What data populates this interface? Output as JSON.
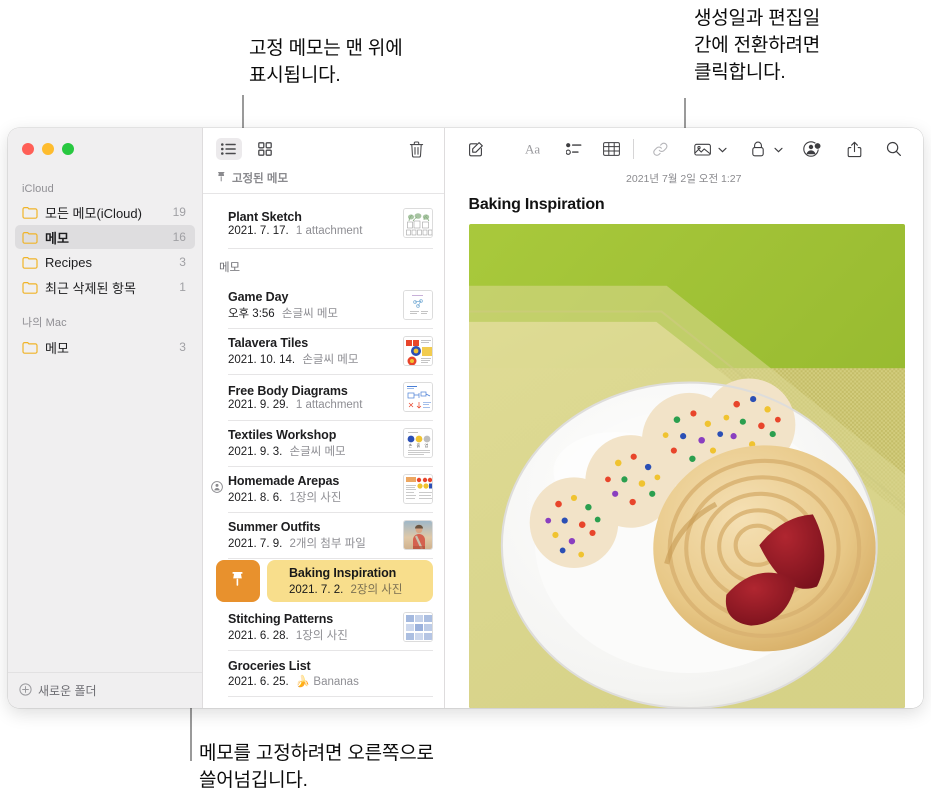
{
  "callouts": [
    {
      "id": "pinned-top",
      "text": "고정 메모는 맨 위에\n표시됩니다."
    },
    {
      "id": "date-toggle",
      "text": "생성일과 편집일\n간에 전환하려면\n클릭합니다."
    },
    {
      "id": "swipe-pin",
      "text": "메모를 고정하려면 오른쪽으로\n쓸어넘깁니다."
    }
  ],
  "window": {
    "traffic_lights": [
      "close",
      "minimize",
      "zoom"
    ],
    "sidebar": {
      "sections": [
        {
          "label": "iCloud",
          "items": [
            {
              "label": "모든 메모(iCloud)",
              "count": "19",
              "selected": false
            },
            {
              "label": "메모",
              "count": "16",
              "selected": true
            },
            {
              "label": "Recipes",
              "count": "3",
              "selected": false
            },
            {
              "label": "최근 삭제된 항목",
              "count": "1",
              "selected": false
            }
          ]
        },
        {
          "label": "나의 Mac",
          "items": [
            {
              "label": "메모",
              "count": "3",
              "selected": false
            }
          ]
        }
      ],
      "footer": {
        "icon": "plus-circle-icon",
        "label": "새로운 폴더"
      }
    },
    "note_list": {
      "toolbar": {
        "list_view_icon": "list-view-icon",
        "gallery_view_icon": "gallery-view-icon",
        "delete_icon": "trash-icon",
        "active_view": "list"
      },
      "pinned_group": {
        "icon": "pin-icon",
        "label": "고정된 메모"
      },
      "pinned_notes": [
        {
          "title": "Plant Sketch",
          "date": "2021. 7. 17.",
          "meta": "1 attachment",
          "thumb": "plant-sketch-thumb",
          "shared": false
        }
      ],
      "notes_group_label": "메모",
      "notes": [
        {
          "title": "Game Day",
          "date": "오후 3:56",
          "meta": "손글씨 메모",
          "thumb": "game-day-thumb",
          "shared": false
        },
        {
          "title": "Talavera Tiles",
          "date": "2021. 10. 14.",
          "meta": "손글씨 메모",
          "thumb": "talavera-thumb",
          "shared": false
        },
        {
          "title": "Free Body Diagrams",
          "date": "2021. 9. 29.",
          "meta": "1 attachment",
          "thumb": "free-body-thumb",
          "shared": false
        },
        {
          "title": "Textiles Workshop",
          "date": "2021. 9. 3.",
          "meta": "손글씨 메모",
          "thumb": "textiles-thumb",
          "shared": false
        },
        {
          "title": "Homemade Arepas",
          "date": "2021. 8. 6.",
          "meta": "1장의 사진",
          "thumb": "arepas-thumb",
          "shared": true
        },
        {
          "title": "Summer Outfits",
          "date": "2021. 7. 9.",
          "meta": "2개의 첨부 파일",
          "thumb": "summer-outfits-thumb",
          "shared": false
        }
      ],
      "swiped_note": {
        "pin_action_icon": "pin-icon",
        "title": "Baking Inspiration",
        "date": "2021. 7. 2.",
        "meta": "2장의 사진"
      },
      "notes_after": [
        {
          "title": "Stitching Patterns",
          "date": "2021. 6. 28.",
          "meta": "1장의 사진",
          "thumb": "stitching-thumb",
          "shared": false
        },
        {
          "title": "Groceries List",
          "date": "2021. 6. 25.",
          "meta": "🍌 Bananas",
          "thumb": "",
          "shared": false
        }
      ]
    },
    "detail": {
      "toolbar": [
        {
          "name": "compose-icon"
        },
        {
          "name": "format-text-icon"
        },
        {
          "name": "checklist-icon"
        },
        {
          "name": "table-icon"
        },
        {
          "name": "link-icon"
        },
        {
          "name": "media-icon",
          "chevron": true
        },
        {
          "name": "lock-icon",
          "chevron": true
        },
        {
          "name": "add-people-icon"
        },
        {
          "name": "share-icon"
        },
        {
          "name": "search-icon"
        }
      ],
      "date": "2021년 7월 2일 오전 1:27",
      "title": "Baking Inspiration",
      "photo": "cookies-on-plate-photo"
    }
  },
  "colors": {
    "pin_orange": "#e8912d",
    "swipe_yellow": "#f8de8c",
    "folder_yellow": "#f0b429",
    "sidebar_bg": "#f0eff0",
    "selected_row": "#dedddf"
  }
}
